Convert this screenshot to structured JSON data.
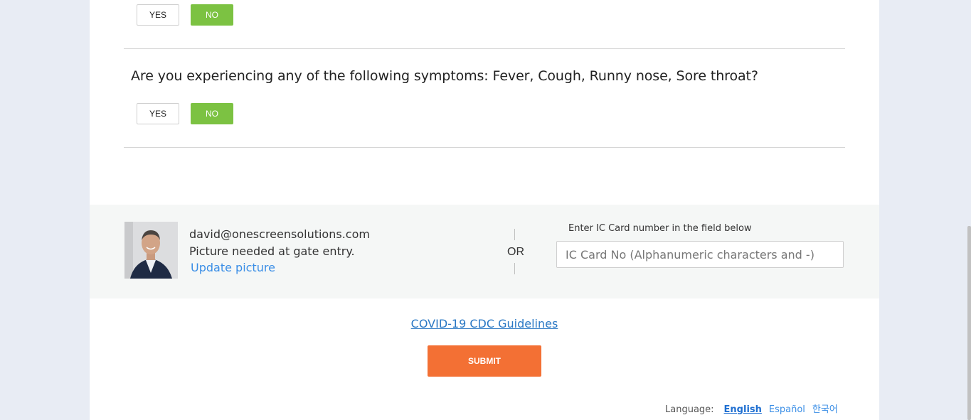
{
  "q1": {
    "yes_label": "YES",
    "no_label": "NO"
  },
  "q2": {
    "text": "Are you experiencing any of the following symptoms: Fever, Cough, Runny nose, Sore throat?",
    "yes_label": "YES",
    "no_label": "NO"
  },
  "profile": {
    "email": "david@onescreensolutions.com",
    "picture_note": "Picture needed at gate entry.",
    "update_link": "Update picture"
  },
  "or_label": "OR",
  "ic_card": {
    "label": "Enter IC Card number in the field below",
    "placeholder": "IC Card No (Alphanumeric characters and -)",
    "value": ""
  },
  "cdc_link": "COVID-19 CDC Guidelines",
  "submit_label": "SUBMIT",
  "language": {
    "label": "Language:",
    "options": [
      "English",
      "Español",
      "한국어"
    ],
    "selected": "English"
  },
  "colors": {
    "no_selected": "#7cc242",
    "submit": "#f37034",
    "link": "#3a8ee6",
    "page_bg": "#e8ecf4"
  }
}
